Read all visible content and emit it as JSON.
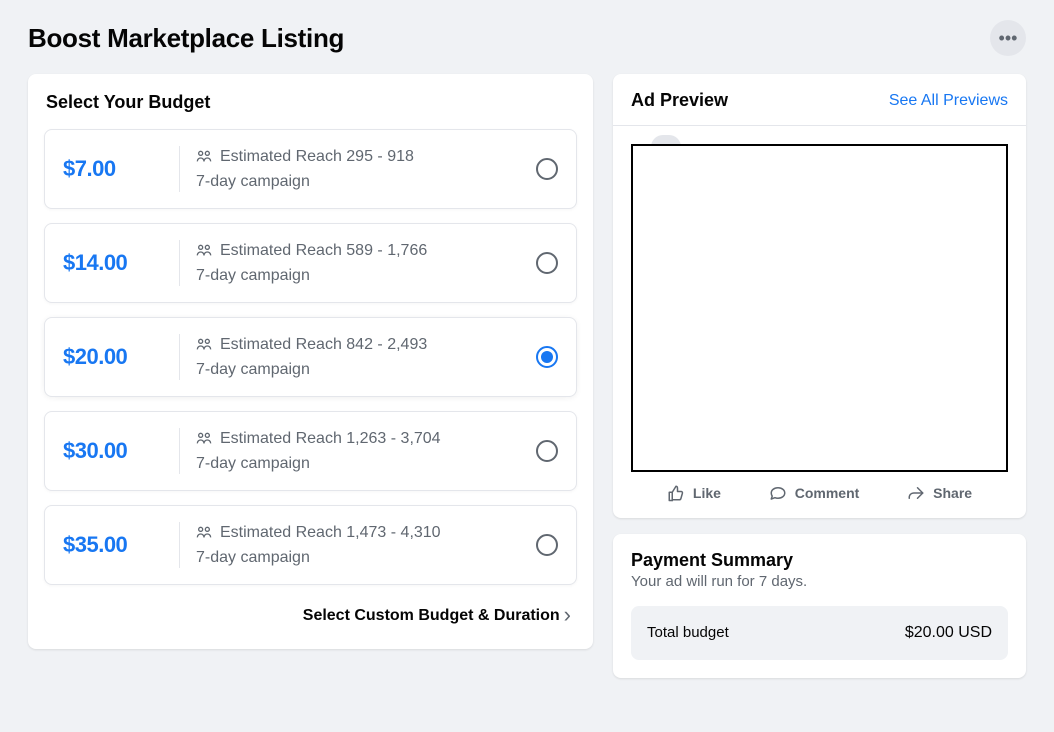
{
  "page_title": "Boost Marketplace Listing",
  "more_btn_glyph": "•••",
  "budget": {
    "title": "Select Your Budget",
    "options": [
      {
        "price": "$7.00",
        "reach_label": "Estimated Reach 295 - 918",
        "duration": "7-day campaign",
        "selected": false
      },
      {
        "price": "$14.00",
        "reach_label": "Estimated Reach 589 - 1,766",
        "duration": "7-day campaign",
        "selected": false
      },
      {
        "price": "$20.00",
        "reach_label": "Estimated Reach 842 - 2,493",
        "duration": "7-day campaign",
        "selected": true
      },
      {
        "price": "$30.00",
        "reach_label": "Estimated Reach 1,263 - 3,704",
        "duration": "7-day campaign",
        "selected": false
      },
      {
        "price": "$35.00",
        "reach_label": "Estimated Reach 1,473 - 4,310",
        "duration": "7-day campaign",
        "selected": false
      }
    ],
    "custom_label": "Select Custom Budget & Duration"
  },
  "preview": {
    "title": "Ad Preview",
    "see_all": "See All Previews",
    "actions": {
      "like": "Like",
      "comment": "Comment",
      "share": "Share"
    }
  },
  "payment": {
    "title": "Payment Summary",
    "subtitle": "Your ad will run for 7 days.",
    "total_label": "Total budget",
    "total_value": "$20.00 USD"
  }
}
